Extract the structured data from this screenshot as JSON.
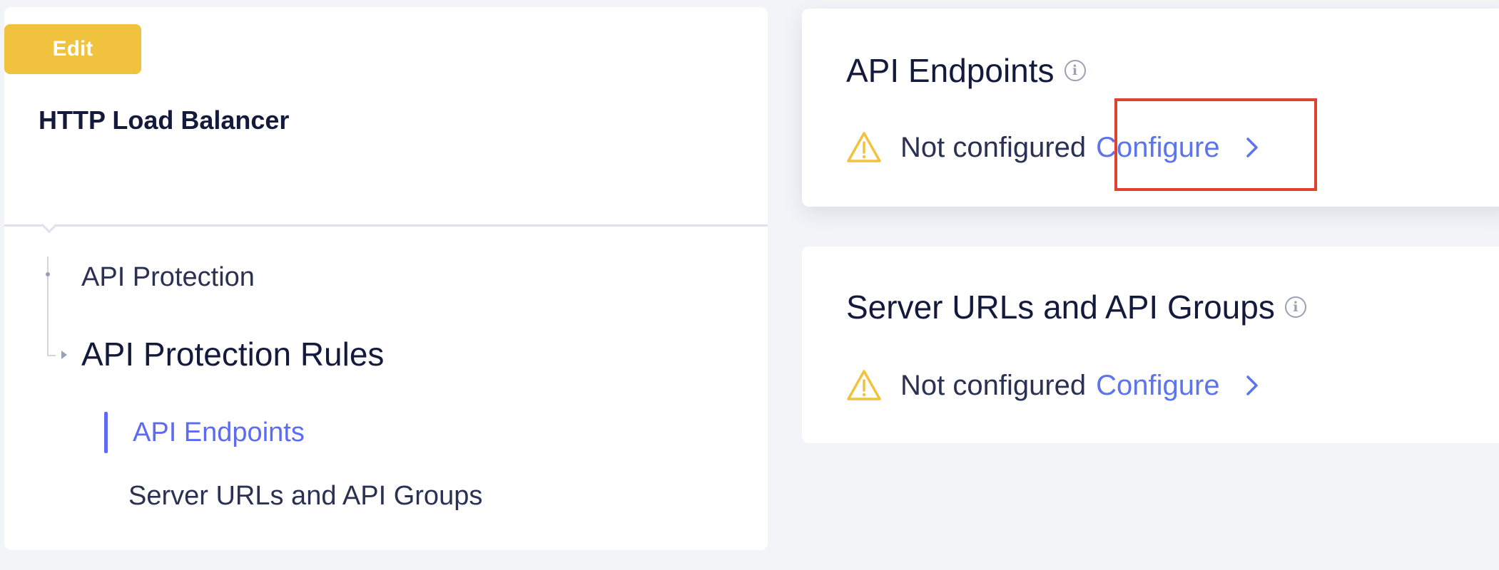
{
  "left_panel": {
    "edit_label": "Edit",
    "title": "HTTP Load Balancer",
    "nav": {
      "api_protection": "API Protection",
      "api_protection_rules": "API Protection Rules",
      "api_endpoints": "API Endpoints",
      "server_urls": "Server URLs and API Groups"
    }
  },
  "cards": [
    {
      "title": "API Endpoints",
      "status": "Not configured",
      "action": "Configure"
    },
    {
      "title": "Server URLs and API Groups",
      "status": "Not configured",
      "action": "Configure"
    }
  ],
  "icons": {
    "info": "info-icon",
    "warning": "warning-triangle-icon",
    "chevron": "chevron-right-icon"
  },
  "colors": {
    "edit_badge": "#f1c23e",
    "link": "#5c74ec",
    "active_nav": "#5c6cf2",
    "warning": "#f1c23e",
    "highlight": "#e4402e"
  }
}
